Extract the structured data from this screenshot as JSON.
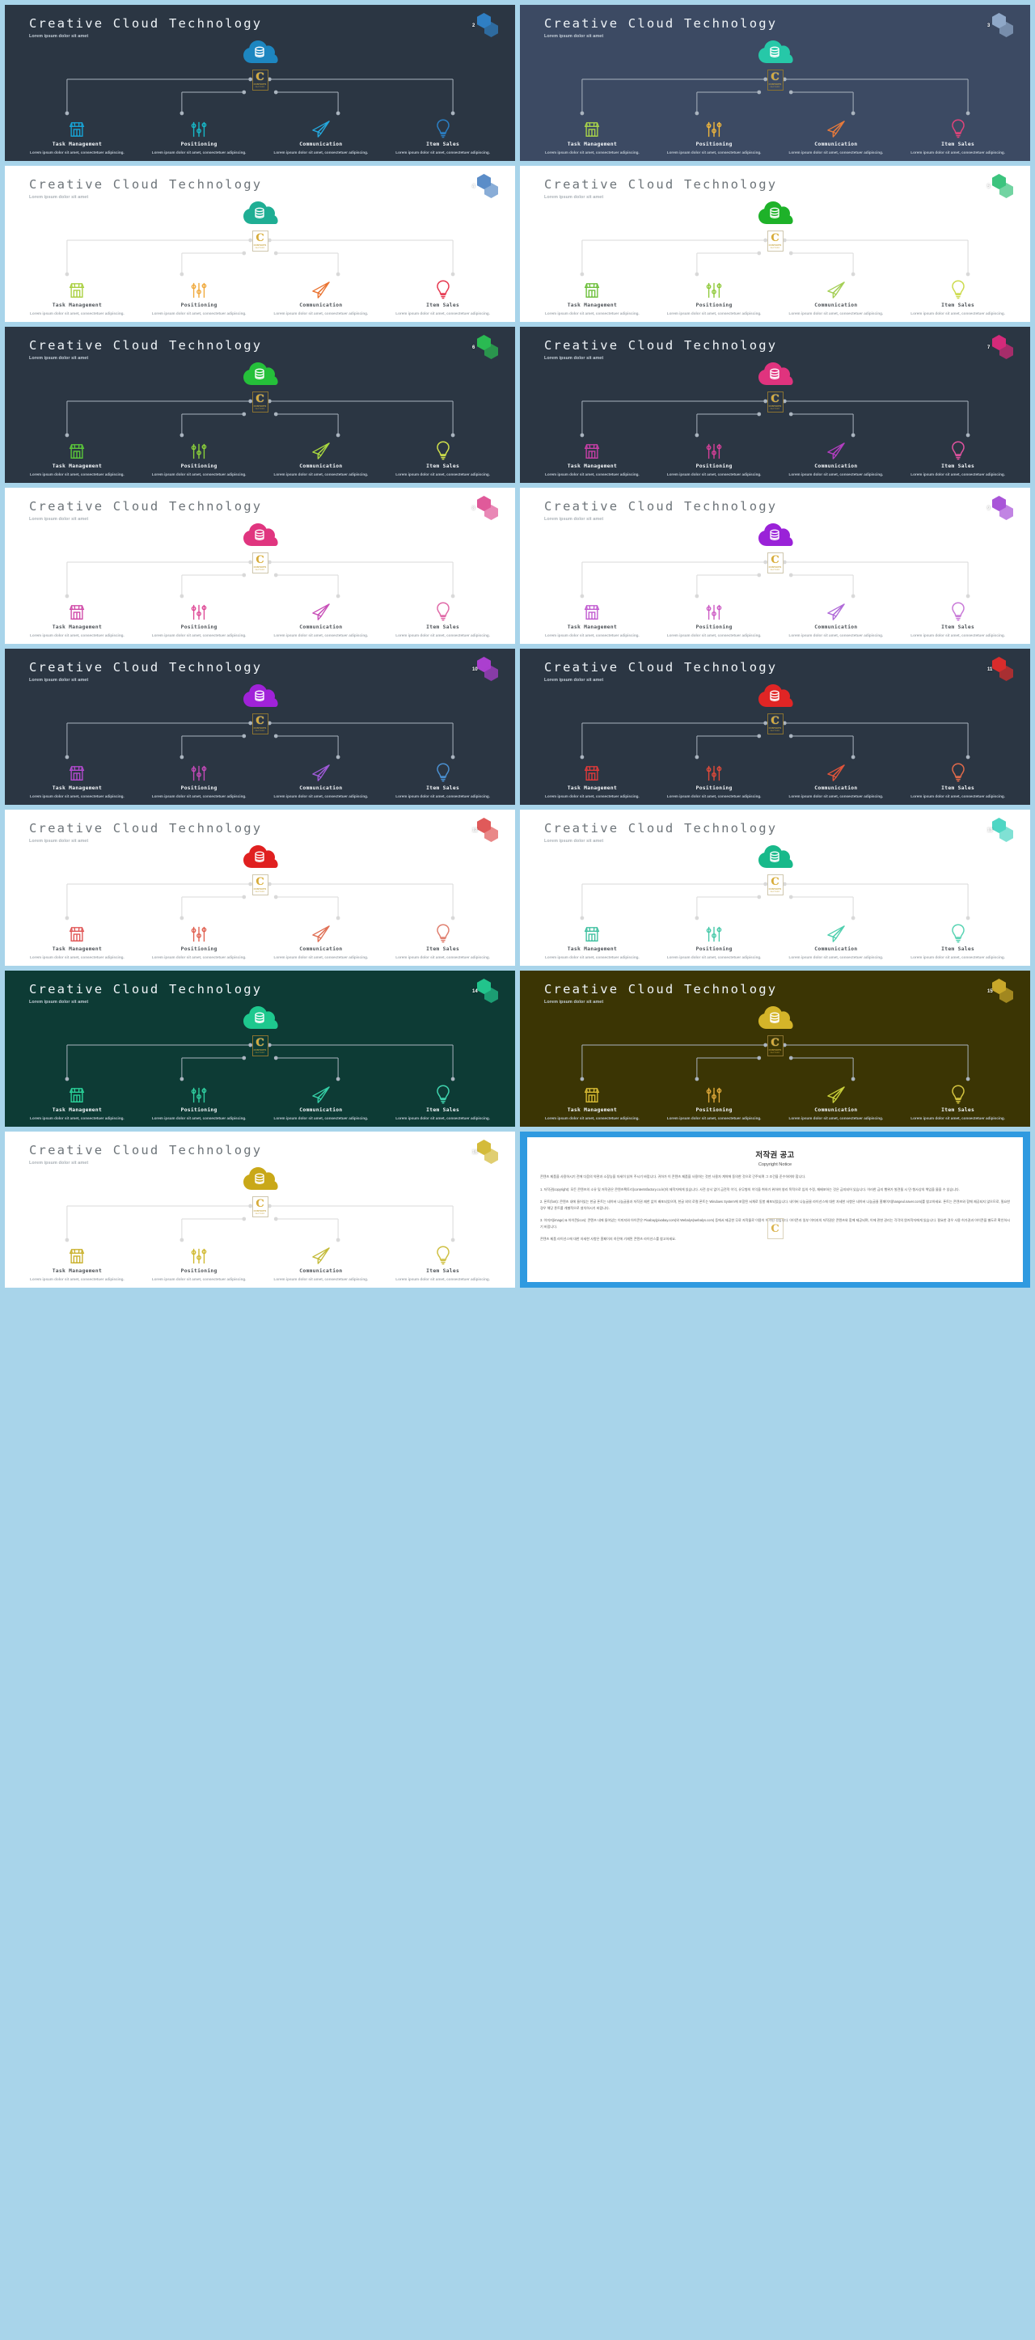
{
  "deck": {
    "title": "Creative Cloud Technology",
    "subtitle": "Lorem ipsum dolor sit amet",
    "item_desc": "Lorem ipsum dolor sit amet, consectetuer adipiscing.",
    "logo_main": "C",
    "logo_line1": "CONTENTS",
    "logo_line2": "FACTORY",
    "items": [
      {
        "label": "Task Management",
        "icon": "shop-icon"
      },
      {
        "label": "Positioning",
        "icon": "sliders-icon"
      },
      {
        "label": "Communication",
        "icon": "paper-plane-icon"
      },
      {
        "label": "Item Sales",
        "icon": "lightbulb-icon"
      }
    ]
  },
  "slides": [
    {
      "number": "2",
      "theme": "dark",
      "accent": "#1d86c0",
      "badge": "#2f7fc4",
      "icon_colors": [
        "#17a5d8",
        "#17b8c8",
        "#25a8dd",
        "#2b7fc4"
      ]
    },
    {
      "number": "3",
      "theme": "dark2",
      "accent": "#26c8a8",
      "badge": "#8fa8c8",
      "icon_colors": [
        "#a9d44a",
        "#f0b63c",
        "#e77a3c",
        "#e0447a"
      ]
    },
    {
      "number": "4",
      "theme": "light",
      "accent": "#1fae94",
      "badge": "#5b8dc8",
      "icon_colors": [
        "#a9cf3f",
        "#f0a93c",
        "#ea7432",
        "#e63950"
      ]
    },
    {
      "number": "5",
      "theme": "light",
      "accent": "#1eb229",
      "badge": "#3cc47e",
      "icon_colors": [
        "#6cbf3a",
        "#8fc93a",
        "#a4cf55",
        "#cddb4e"
      ]
    },
    {
      "number": "6",
      "theme": "dark",
      "accent": "#25c03a",
      "badge": "#2aba52",
      "icon_colors": [
        "#5bc83a",
        "#8ad03a",
        "#a9d83f",
        "#cfe04b"
      ]
    },
    {
      "number": "7",
      "theme": "dark",
      "accent": "#e0337e",
      "badge": "#d42a7a",
      "icon_colors": [
        "#c93fa8",
        "#d7409a",
        "#b33ec0",
        "#e0529f"
      ]
    },
    {
      "number": "8",
      "theme": "light",
      "accent": "#e0357f",
      "badge": "#e05a9a",
      "icon_colors": [
        "#d04aa8",
        "#de4a96",
        "#c850b8",
        "#e06aa8"
      ]
    },
    {
      "number": "9",
      "theme": "light",
      "accent": "#9a22d8",
      "badge": "#a955d8",
      "icon_colors": [
        "#c15ad0",
        "#cc5ac4",
        "#b06ad8",
        "#c97ad8"
      ]
    },
    {
      "number": "10",
      "theme": "dark",
      "accent": "#a022d8",
      "badge": "#ab3fcf",
      "icon_colors": [
        "#b44ad0",
        "#c44ab8",
        "#a05ad8",
        "#4a8fd0"
      ]
    },
    {
      "number": "11",
      "theme": "dark",
      "accent": "#e02525",
      "badge": "#d82c2c",
      "icon_colors": [
        "#e03a3a",
        "#e04a3a",
        "#e0543a",
        "#e06a4a"
      ]
    },
    {
      "number": "12",
      "theme": "light",
      "accent": "#e02020",
      "badge": "#e05a5a",
      "icon_colors": [
        "#e05555",
        "#e06050",
        "#e07055",
        "#e08070"
      ]
    },
    {
      "number": "13",
      "theme": "light",
      "accent": "#18b98a",
      "badge": "#4fd6c4",
      "icon_colors": [
        "#3fc0a0",
        "#45c8a8",
        "#4fcfae",
        "#5ad4b4"
      ]
    },
    {
      "number": "14",
      "theme": "teal",
      "accent": "#1ec88e",
      "badge": "#22c48c",
      "icon_colors": [
        "#2ad49a",
        "#2fd0a0",
        "#35cfa6",
        "#3fd4ae"
      ]
    },
    {
      "number": "15",
      "theme": "olive",
      "accent": "#d4b429",
      "badge": "#c9a82a",
      "icon_colors": [
        "#d8bb33",
        "#e0a93a",
        "#c9cf3a",
        "#d4c43f"
      ]
    },
    {
      "number": "16",
      "theme": "light",
      "accent": "#c9a818",
      "badge": "#d4bb3a",
      "icon_colors": [
        "#c9b02a",
        "#d0b82f",
        "#c4bb3a",
        "#cfc044"
      ]
    }
  ],
  "copyright": {
    "title": "저작권 공고",
    "subtitle": "Copyright Notice",
    "intro": "콘텐츠 제품을 사용하시기 전에 다음의 약관과 소장능을 자세히 읽어 주시기 바랍니다. 귀하가 이 콘텐츠 제품을 사용하는 것만 사용자 계약에 동의한 것으로 간주되며 그 조건을 준수하여야 합니다.",
    "para1": "1. 저작권(copyright): 모든 콘텐츠의 소유 및 저작권은 콘텐츠팩토리(contentsfactory.co.kr)의 제작자에게 있습니다. 사전 승낙 없이 금전적 이익, 유무형의 이익을 취하기 위하여 영리 목적으로 임의 수정, 재배포하는 것은 금지되어 있습니다. 이러한 금지 행위가 발견될 시 민·형사상의 책임을 물을 수 있습니다.",
    "para2": "2. 폰트(font): 콘텐츠 내에 들어있는 한글 폰트는 네이버 나눔글꼴과 저작권 제한 없이 배포되었으며, 한글 외의 로컬 폰트는 Windows System에 포함된 서체로 동봉 배포되었습니다. 네이버 나눔글꼴 라이선스에 대한 자세한 사항은 네이버 나눔글꼴 홈페이지(hangeul.naver.com)를 참고하세요. 폰트는 콘텐츠와 함께 제공되지 않으므로, 필요한 경우 해당 폰트를 개별적으로 설치하시기 바랍니다.",
    "para3": "3. 이미지(image) & 아이콘(icon): 콘텐츠 내에 들어있는 이미지와 아이콘은 Pixabay(pixabay.com)와 Webalys(webalys.com) 등에서 제공한 무료 저작물로 이용이 허가된 것입니다. 아이콘과 일부 이미지의 저작권은 콘텐츠와 함께 제공되며, 이에 관한 권리는 각각의 원저작자에게 있습니다. 필요한 경우 사용 허가권과 아이콘을 별도로 확인하시기 바랍니다.",
    "closing": "콘텐츠 제품 라이선스에 대한 자세한 사항은 홈페이지 하단에 기재된 콘텐츠 라이선스를 참고하세요."
  }
}
